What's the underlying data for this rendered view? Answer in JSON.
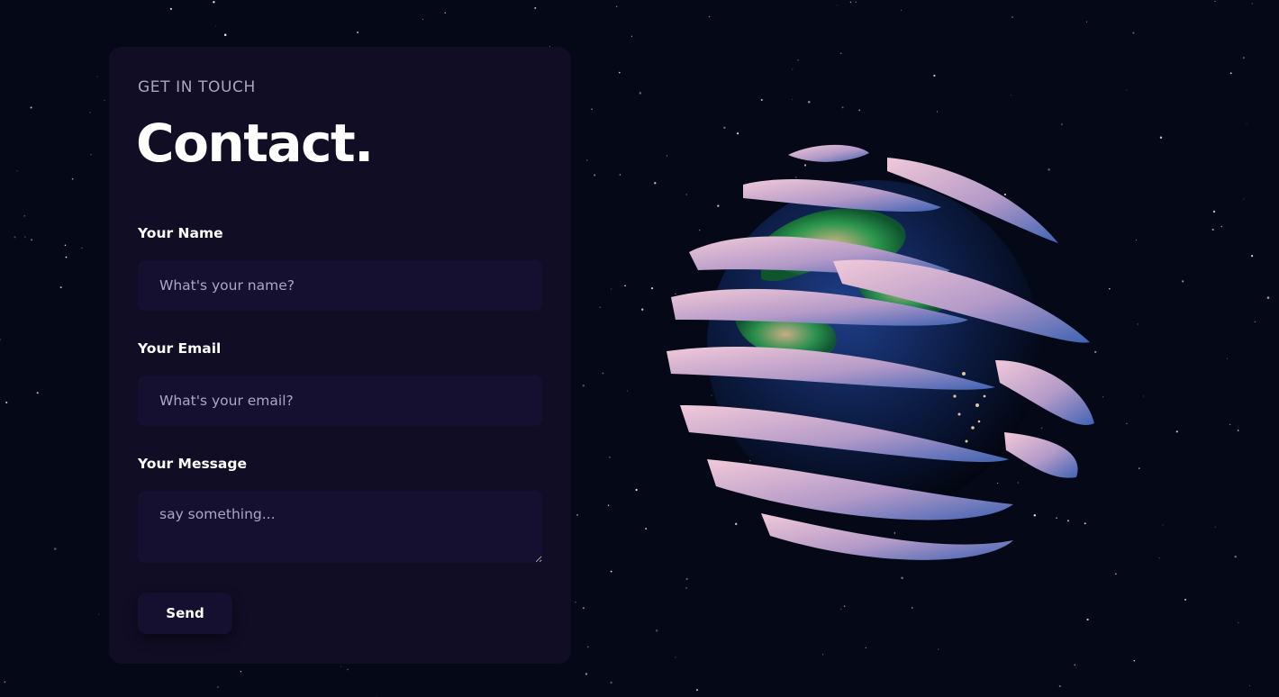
{
  "contact": {
    "eyebrow": "GET IN TOUCH",
    "title": "Contact.",
    "fields": {
      "name": {
        "label": "Your Name",
        "placeholder": "What's your name?",
        "value": ""
      },
      "email": {
        "label": "Your Email",
        "placeholder": "What's your email?",
        "value": ""
      },
      "message": {
        "label": "Your Message",
        "placeholder": "say something...",
        "value": ""
      }
    },
    "send_label": "Send"
  },
  "colors": {
    "background": "#050816",
    "card": "#100d25",
    "input": "#151030",
    "secondary_text": "#aaa6c3",
    "text": "#ffffff"
  },
  "illustration": {
    "icon": "earth-planet-icon"
  }
}
